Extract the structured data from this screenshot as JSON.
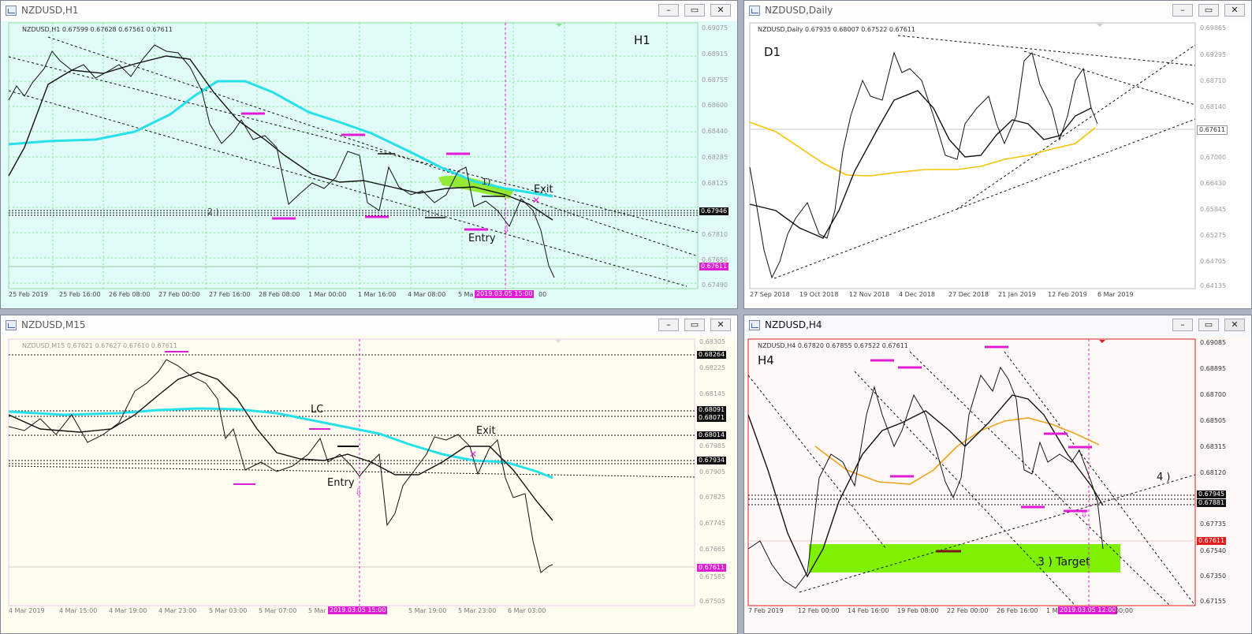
{
  "colors": {
    "h1_bg": "#e1fbf8",
    "d1_bg": "#ffffff",
    "m15_bg": "#fffdf0",
    "h4_bg": "#fffaf8",
    "grid_h1": "#7dea8a",
    "grid_m15": "#f0b8f0",
    "grid_h4": "#f2bcbc",
    "ma_cyan": "#26e1ea",
    "ma_gold": "#f7c300",
    "ma_orange": "#f3a21c",
    "magenta": "#e01cd7",
    "lime": "#7ff000"
  },
  "windows": {
    "h1": {
      "title": "NZDUSD,H1",
      "symbol_line": "NZDUSD,H1  0.67599 0.67628 0.67561 0.67611",
      "tf_label": "H1",
      "prices": [
        "0.69075",
        "0.68915",
        "0.68755",
        "0.68600",
        "0.68440",
        "0.68285",
        "0.68125",
        "0.67946",
        "0.67810",
        "0.67650",
        "0.67611",
        "0.67490"
      ],
      "times": [
        "25 Feb 2019",
        "25 Feb 16:00",
        "26 Feb 08:00",
        "27 Feb 00:00",
        "27 Feb 16:00",
        "28 Feb 08:00",
        "1 Mar 00:00",
        "1 Mar 16:00",
        "4 Mar 08:00",
        "5 Ma",
        "00"
      ],
      "time_marker": "2019.03.05 15:00",
      "notes": {
        "n1": "1)",
        "n2": "2 )",
        "exit": "Exit",
        "entry": "Entry"
      }
    },
    "d1": {
      "title": "NZDUSD,Daily",
      "symbol_line": "NZDUSD,Daily  0.67935 0.68007 0.67522 0.67611",
      "tf_label": "D1",
      "prices": [
        "0.69865",
        "0.69295",
        "0.68710",
        "0.68140",
        "0.67611",
        "0.67000",
        "0.66430",
        "0.65845",
        "0.65275",
        "0.64705",
        "0.64135"
      ],
      "times": [
        "27 Sep 2018",
        "19 Oct 2018",
        "12 Nov 2018",
        "4 Dec 2018",
        "27 Dec 2018",
        "21 Jan 2019",
        "12 Feb 2019",
        "6 Mar 2019"
      ]
    },
    "m15": {
      "title": "NZDUSD,M15",
      "symbol_line": "NZDUSD,M15  0.67621 0.67627 0.67610 0.67611",
      "prices": [
        "0.68305",
        "0.68264",
        "0.68225",
        "0.68145",
        "0.68091",
        "0.68071",
        "0.68014",
        "0.67985",
        "0.67934",
        "0.67905",
        "0.67825",
        "0.67745",
        "0.67665",
        "0.67611",
        "0.67585",
        "0.67505"
      ],
      "times": [
        "4 Mar 2019",
        "4 Mar 15:00",
        "4 Mar 19:00",
        "4 Mar 23:00",
        "5 Mar 03:00",
        "5 Mar 07:00",
        "5 Mar",
        "5 Mar 19:00",
        "5 Mar 23:00",
        "6 Mar 03:00"
      ],
      "time_marker": "2019.03.05 15:00",
      "notes": {
        "lc": "LC",
        "exit": "Exit",
        "entry": "Entry"
      }
    },
    "h4": {
      "title": "NZDUSD,H4",
      "symbol_line": "NZDUSD,H4  0.67820 0.67855 0.67522 0.67611",
      "tf_label": "H4",
      "prices": [
        "0.69085",
        "0.68895",
        "0.68700",
        "0.68505",
        "0.68315",
        "0.68120",
        "0.67945",
        "0.67881",
        "0.67735",
        "0.67611",
        "0.67540",
        "0.67350",
        "0.67155"
      ],
      "times": [
        "7 Feb 2019",
        "12 Feb 00:00",
        "14 Feb 16:00",
        "19 Feb 08:00",
        "22 Feb 00:00",
        "26 Feb 16:00",
        "1 M",
        "00:00"
      ],
      "time_marker": "2019.03.05 12:00",
      "notes": {
        "n4": "4 )",
        "target": "3 ) Target"
      }
    }
  }
}
